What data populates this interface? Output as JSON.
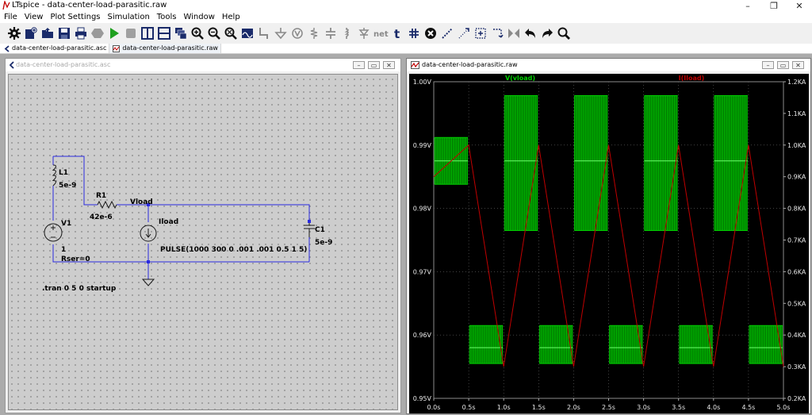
{
  "app": {
    "title": "LTspice - data-center-load-parasitic.raw"
  },
  "window_controls": {
    "minimize": "–",
    "maximize": "❐",
    "close": "✕"
  },
  "menu": [
    "File",
    "View",
    "Plot Settings",
    "Simulation",
    "Tools",
    "Window",
    "Help"
  ],
  "toolbar": {
    "icons": [
      "gear-icon",
      "new-schematic-icon",
      "open-icon",
      "save-icon",
      "print-icon",
      "hexagon-icon",
      "run-icon",
      "stop-icon",
      "tile-vertical-icon",
      "tile-horizontal-icon",
      "cascade-icon",
      "zoom-in-icon",
      "zoom-out-icon",
      "zoom-fit-icon",
      "autorange-icon",
      "wire-icon",
      "ground-icon",
      "label-net-icon",
      "resistor-icon",
      "capacitor-icon",
      "inductor-icon",
      "diode-icon",
      "net-icon",
      "text-icon",
      "spice-directive-icon",
      "delete-icon",
      "duplicate-icon",
      "move-icon",
      "drag-icon",
      "rotate-icon",
      "mirror-icon",
      "undo-icon",
      "redo-icon",
      "find-icon"
    ],
    "net_label": "net",
    "text_label": "t"
  },
  "tabs": [
    {
      "label": "data-center-load-parasitic.asc",
      "icon": "schematic-icon"
    },
    {
      "label": "data-center-load-parasitic.raw",
      "icon": "waveform-icon"
    }
  ],
  "schematic": {
    "window_title": "data-center-load-parasitic.asc",
    "components": {
      "L1": {
        "name": "L1",
        "value": "5e-9"
      },
      "R1": {
        "name": "R1",
        "value": "42e-6"
      },
      "V1": {
        "name": "V1",
        "value": "1",
        "extra": "Rser=0"
      },
      "Iload": {
        "name": "Iload",
        "value": "PULSE(1000 300 0 .001 .001 0.5 1 5)"
      },
      "C1": {
        "name": "C1",
        "value": "5e-9"
      }
    },
    "net_label": "Vload",
    "directive": ".tran 0 5 0 startup"
  },
  "plot": {
    "window_title": "data-center-load-parasitic.raw",
    "traces": [
      {
        "name": "V(vload)",
        "color": "#00d000"
      },
      {
        "name": "I(Iload)",
        "color": "#c00000"
      }
    ],
    "background": "#000000"
  },
  "chart_data": {
    "type": "line",
    "x": [
      0,
      0.5,
      0.5,
      1.0,
      1.0,
      1.5,
      1.5,
      2.0,
      2.0,
      2.5,
      2.5,
      3.0,
      3.0,
      3.5,
      3.5,
      4.0,
      4.0,
      4.5,
      4.5,
      5.0
    ],
    "series": [
      {
        "name": "I(Iload)",
        "axis": "right",
        "unit": "A",
        "values": [
          900,
          1000,
          1000,
          300,
          300,
          1000,
          1000,
          300,
          300,
          1000,
          1000,
          300,
          300,
          1000,
          1000,
          300,
          300,
          1000,
          1000,
          300
        ]
      },
      {
        "name": "V(vload)",
        "axis": "left",
        "unit": "V",
        "bands": [
          {
            "t0": 0.0,
            "t1": 0.5,
            "lo": 0.9838,
            "hi": 0.9912,
            "mid": 0.9875
          },
          {
            "t0": 0.5,
            "t1": 1.0,
            "lo": 0.9555,
            "hi": 0.9615,
            "mid": 0.958
          },
          {
            "t0": 1.0,
            "t1": 1.5,
            "lo": 0.9765,
            "hi": 0.9978,
            "mid": 0.9875
          },
          {
            "t0": 1.5,
            "t1": 2.0,
            "lo": 0.9555,
            "hi": 0.9615,
            "mid": 0.958
          },
          {
            "t0": 2.0,
            "t1": 2.5,
            "lo": 0.9765,
            "hi": 0.9978,
            "mid": 0.9875
          },
          {
            "t0": 2.5,
            "t1": 3.0,
            "lo": 0.9555,
            "hi": 0.9615,
            "mid": 0.958
          },
          {
            "t0": 3.0,
            "t1": 3.5,
            "lo": 0.9765,
            "hi": 0.9978,
            "mid": 0.9875
          },
          {
            "t0": 3.5,
            "t1": 4.0,
            "lo": 0.9555,
            "hi": 0.9615,
            "mid": 0.958
          },
          {
            "t0": 4.0,
            "t1": 4.5,
            "lo": 0.9765,
            "hi": 0.9978,
            "mid": 0.9875
          },
          {
            "t0": 4.5,
            "t1": 5.0,
            "lo": 0.9555,
            "hi": 0.9615,
            "mid": 0.958
          }
        ]
      }
    ],
    "x_ticks": [
      "0.0s",
      "0.5s",
      "1.0s",
      "1.5s",
      "2.0s",
      "2.5s",
      "3.0s",
      "3.5s",
      "4.0s",
      "4.5s",
      "5.0s"
    ],
    "y_left_ticks": [
      "1.00V",
      "0.99V",
      "0.98V",
      "0.97V",
      "0.96V",
      "0.95V"
    ],
    "y_right_ticks": [
      "1.2KA",
      "1.1KA",
      "1.0KA",
      "0.9KA",
      "0.8KA",
      "0.7KA",
      "0.6KA",
      "0.5KA",
      "0.4KA",
      "0.3KA",
      "0.2KA"
    ],
    "xlim": [
      0,
      5
    ],
    "ylim_left": [
      0.95,
      1.0
    ],
    "ylim_right": [
      200,
      1200
    ],
    "grid": true,
    "legend": "top"
  }
}
